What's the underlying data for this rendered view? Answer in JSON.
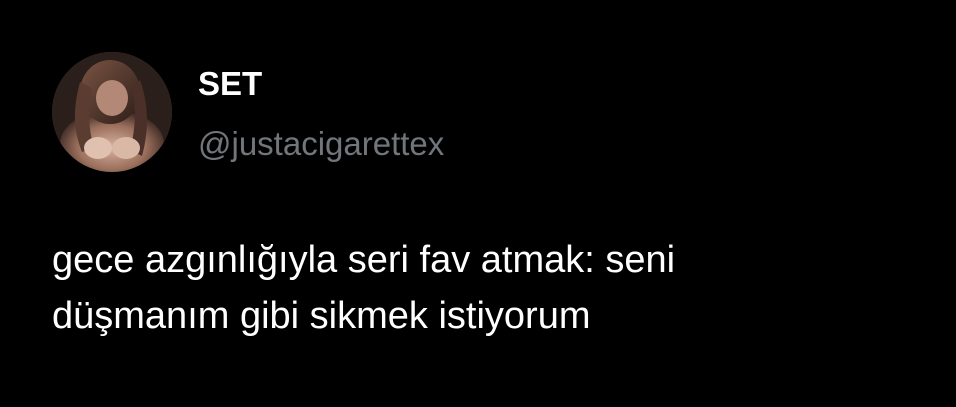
{
  "author": {
    "display_name": "SET",
    "handle": "@justacigarettex",
    "avatar_icon": "profile-photo"
  },
  "tweet": {
    "line1": "gece azgınlığıyla seri fav atmak: seni",
    "line2": "düşmanım gibi sikmek istiyorum"
  },
  "colors": {
    "background": "#000000",
    "text": "#ffffff",
    "secondary_text": "#71767b"
  }
}
